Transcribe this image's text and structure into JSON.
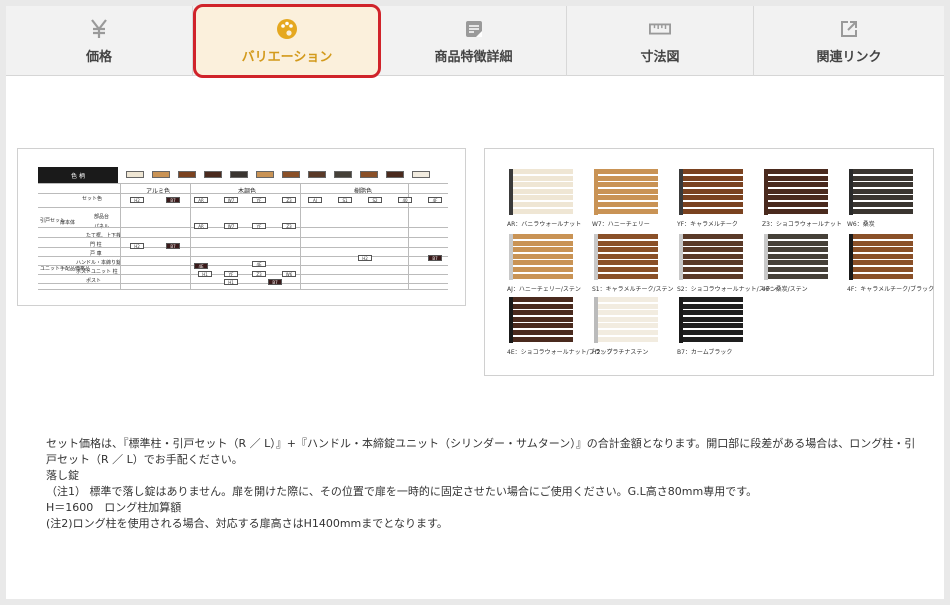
{
  "tabs": [
    {
      "label": "価格",
      "icon": "yen-icon"
    },
    {
      "label": "バリエーション",
      "icon": "palette-icon",
      "active": true
    },
    {
      "label": "商品特徴詳細",
      "icon": "document-icon"
    },
    {
      "label": "寸法図",
      "icon": "ruler-icon"
    },
    {
      "label": "関連リンク",
      "icon": "external-link-icon"
    }
  ],
  "spec_table": {
    "title": "色 柄",
    "groups": [
      "アルミ色",
      "木調色",
      "樹脂色"
    ],
    "rows": [
      "セット色",
      "扉本体",
      "部品台",
      "パネル",
      "たて框、上下桟",
      "門 柱",
      "戸 車",
      "ハンドル・本締り錠",
      "ポストユニット 柱",
      "ポスト"
    ],
    "row_group_labels": [
      "引戸セット",
      "ユニット手配品価格品"
    ],
    "codes": [
      "H2",
      "B7",
      "AR",
      "W7",
      "YF",
      "Z3",
      "W6",
      "AJ",
      "S1",
      "S2",
      "40",
      "4F",
      "4E",
      "H1"
    ]
  },
  "swatches": [
    {
      "code": "AR",
      "label": "AR：バニラウォールナット",
      "slat": "#efe6d4",
      "post": "#3a3a3a"
    },
    {
      "code": "W7",
      "label": "W7：ハニーチェリー",
      "slat": "#c99355",
      "post": "#c99355"
    },
    {
      "code": "YF",
      "label": "YF：キャラメルチーク",
      "slat": "#7a4220",
      "post": "#3a3a3a"
    },
    {
      "code": "Z3",
      "label": "Z3：ショコラウォールナット",
      "slat": "#4a2a1e",
      "post": "#4a2a1e"
    },
    {
      "code": "W6",
      "label": "W6：桑炭",
      "slat": "#3a3530",
      "post": "#2a2a2a"
    },
    {
      "code": "AJ",
      "label": "AJ：ハニーチェリー/ステン",
      "slat": "#c99355",
      "post": "#c8c8c8"
    },
    {
      "code": "S1",
      "label": "S1：キャラメルチーク/ステン",
      "slat": "#8a5028",
      "post": "#c8c8c8"
    },
    {
      "code": "S2",
      "label": "S2：ショコラウォールナット/ステン",
      "slat": "#5a3a28",
      "post": "#c8c8c8"
    },
    {
      "code": "40",
      "label": "40：桑炭/ステン",
      "slat": "#454038",
      "post": "#c8c8c8"
    },
    {
      "code": "4F",
      "label": "4F：キャラメルチーク/ブラック",
      "slat": "#8a5028",
      "post": "#1a1a1a"
    },
    {
      "code": "4E",
      "label": "4E：ショコラウォールナット/ブラック",
      "slat": "#4a2a1e",
      "post": "#1a1a1a"
    },
    {
      "code": "H2",
      "label": "H2：プラチナステン",
      "slat": "#f2ece0",
      "post": "#bbbbbb"
    },
    {
      "code": "B7",
      "label": "B7：カームブラック",
      "slat": "#1f1f1f",
      "post": "#1a1a1a"
    }
  ],
  "notes": [
    "セット価格は、『標準柱・引戸セット（R ／ L）』+『ハンドル・本締錠ユニット（シリンダー・サムターン）』の合計金額となります。開口部に段差がある場合は、ロング柱・引戸セット（R ／ L）でお手配ください。",
    "落し錠",
    "（注1） 標準で落し錠はありません。扉を開けた際に、その位置で扉を一時的に固定させたい場合にご使用ください。G.L高さ80mm専用です。",
    "H＝1600　ロング柱加算額",
    "(注2)ロング柱を使用される場合、対応する扉高さはH1400mmまでとなります。"
  ],
  "colors": {
    "active_border": "#d0232a",
    "active_bg": "#fbf0dc",
    "active_text": "#d39a1c",
    "icon": "#999999",
    "palette_icon": "#e5a820"
  }
}
